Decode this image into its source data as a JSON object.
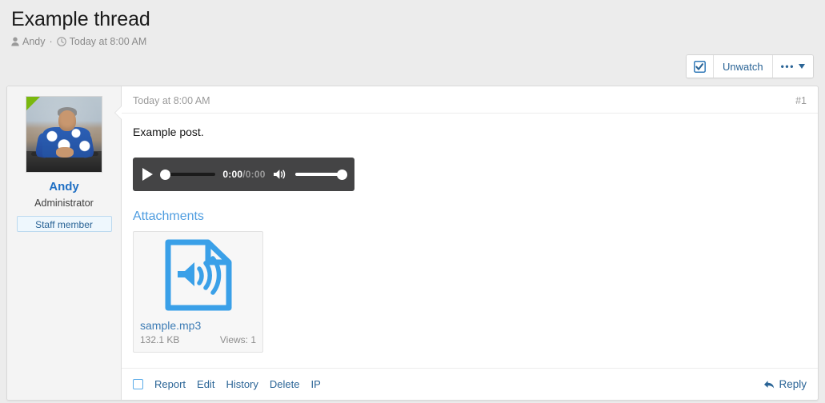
{
  "thread": {
    "title": "Example thread",
    "author": "Andy",
    "separator": "·",
    "date": "Today at 8:00 AM",
    "author_icon": "user-icon",
    "date_icon": "clock-icon"
  },
  "actions": {
    "watch_icon": "checked-checkbox-icon",
    "watch_label": "Unwatch",
    "more_icon": "ellipsis-caret-icon"
  },
  "post": {
    "date": "Today at 8:00 AM",
    "number": "#1",
    "text": "Example post.",
    "author": {
      "name": "Andy",
      "title": "Administrator",
      "badge": "Staff member",
      "online_marker": "online-indicator",
      "avatar_alt": "Andy avatar photo"
    },
    "audio": {
      "play_icon": "play-icon",
      "current_time": "0:00",
      "separator": "/",
      "duration": "0:00",
      "volume_icon": "speaker-icon",
      "progress_percent": 0,
      "volume_percent": 100
    },
    "attachments_heading": "Attachments",
    "attachments": [
      {
        "icon": "audio-file-icon",
        "name": "sample.mp3",
        "size": "132.1 KB",
        "views": "Views: 1"
      }
    ],
    "footer": {
      "select_checkbox": "post-select",
      "links": [
        "Report",
        "Edit",
        "History",
        "Delete",
        "IP"
      ],
      "reply_icon": "reply-arrow-icon",
      "reply_label": "Reply"
    }
  },
  "colors": {
    "link": "#2a6496",
    "accent_blue": "#4f9de0",
    "username": "#1f6fc4",
    "online": "#7ab80e",
    "player_bg": "#444445"
  }
}
